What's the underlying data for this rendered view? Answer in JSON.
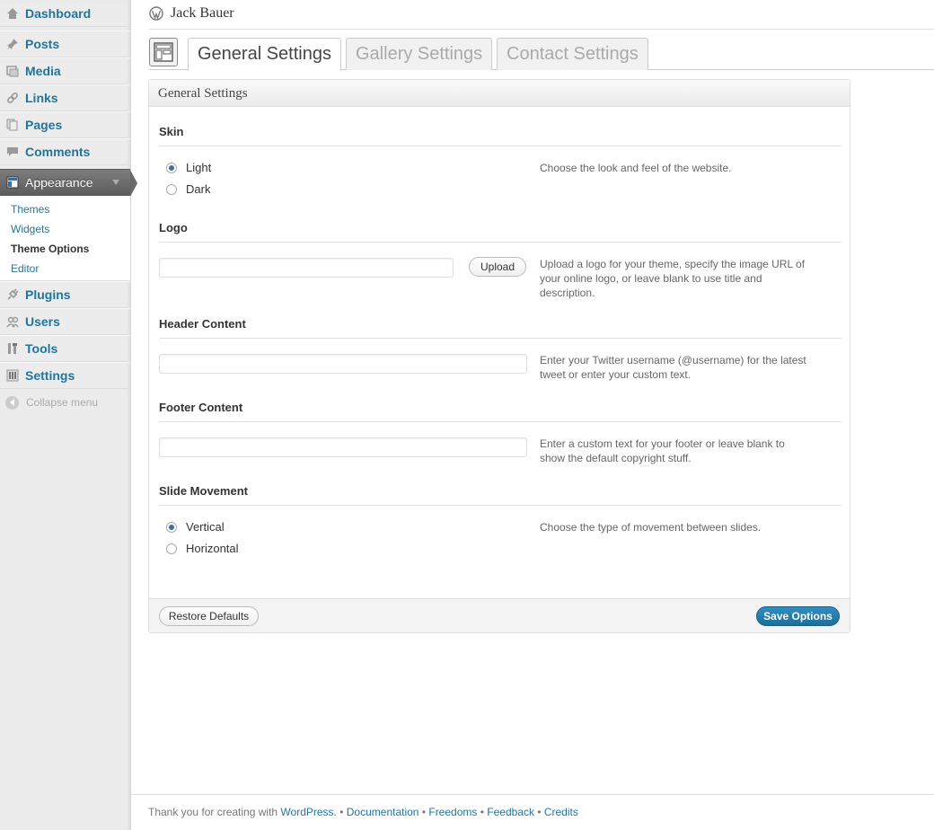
{
  "sidebar": {
    "items": [
      {
        "label": "Dashboard",
        "icon": "dashboard-icon"
      },
      {
        "label": "Posts",
        "icon": "pushpin-icon"
      },
      {
        "label": "Media",
        "icon": "media-icon"
      },
      {
        "label": "Links",
        "icon": "link-icon"
      },
      {
        "label": "Pages",
        "icon": "pages-icon"
      },
      {
        "label": "Comments",
        "icon": "comment-icon"
      },
      {
        "label": "Appearance",
        "icon": "appearance-icon",
        "active": true
      },
      {
        "label": "Plugins",
        "icon": "plugin-icon"
      },
      {
        "label": "Users",
        "icon": "users-icon"
      },
      {
        "label": "Tools",
        "icon": "tools-icon"
      },
      {
        "label": "Settings",
        "icon": "settings-icon"
      }
    ],
    "submenu": [
      "Themes",
      "Widgets",
      "Theme Options",
      "Editor"
    ],
    "submenu_current": "Theme Options",
    "collapse_label": "Collapse menu"
  },
  "header": {
    "site_title": "Jack Bauer"
  },
  "tabs": [
    {
      "label": "General Settings",
      "active": true
    },
    {
      "label": "Gallery Settings",
      "active": false
    },
    {
      "label": "Contact Settings",
      "active": false
    }
  ],
  "panel": {
    "title": "General Settings",
    "skin": {
      "title": "Skin",
      "options": [
        "Light",
        "Dark"
      ],
      "selected": "Light",
      "description": "Choose the look and feel of the website."
    },
    "logo": {
      "title": "Logo",
      "value": "",
      "upload_label": "Upload",
      "description": "Upload a logo for your theme, specify the image URL of your online logo, or leave blank to use title and description."
    },
    "header_content": {
      "title": "Header Content",
      "value": "",
      "description": "Enter your Twitter username (@username) for the latest tweet or enter your custom text."
    },
    "footer_content": {
      "title": "Footer Content",
      "value": "",
      "description": "Enter a custom text for your footer or leave blank to show the default copyright stuff."
    },
    "slide_movement": {
      "title": "Slide Movement",
      "options": [
        "Vertical",
        "Horizontal"
      ],
      "selected": "Vertical",
      "description": "Choose the type of movement between slides."
    },
    "restore_label": "Restore Defaults",
    "save_label": "Save Options"
  },
  "footer": {
    "thanks": "Thank you for creating with",
    "wordpress": "WordPress.",
    "sep": " • ",
    "links": [
      "Documentation",
      "Freedoms",
      "Feedback",
      "Credits"
    ]
  },
  "colors": {
    "link": "#21759b",
    "primary_button": "#21759b",
    "sidebar_bg": "#ececec"
  }
}
